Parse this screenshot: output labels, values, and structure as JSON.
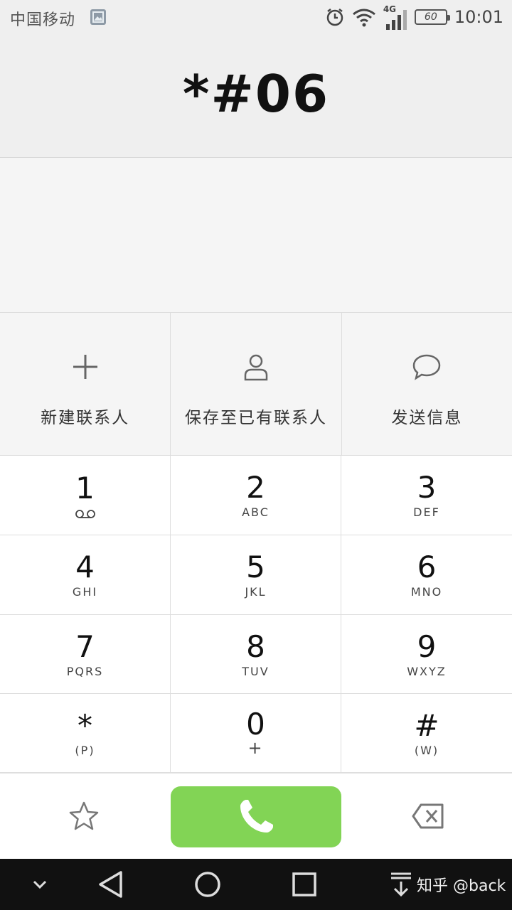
{
  "status_bar": {
    "carrier": "中国移动",
    "network_type": "4G",
    "battery_level": "60",
    "time": "10:01",
    "icons": [
      "image-notification-icon",
      "alarm-icon",
      "wifi-icon",
      "signal-icon",
      "battery-icon"
    ]
  },
  "dialer": {
    "number": "*#06"
  },
  "actions": [
    {
      "label": "新建联系人",
      "icon": "plus-icon"
    },
    {
      "label": "保存至已有联系人",
      "icon": "person-icon"
    },
    {
      "label": "发送信息",
      "icon": "message-bubble-icon"
    }
  ],
  "keypad": [
    {
      "digit": "1",
      "letters": ""
    },
    {
      "digit": "2",
      "letters": "ABC"
    },
    {
      "digit": "3",
      "letters": "DEF"
    },
    {
      "digit": "4",
      "letters": "GHI"
    },
    {
      "digit": "5",
      "letters": "JKL"
    },
    {
      "digit": "6",
      "letters": "MNO"
    },
    {
      "digit": "7",
      "letters": "PQRS"
    },
    {
      "digit": "8",
      "letters": "TUV"
    },
    {
      "digit": "9",
      "letters": "WXYZ"
    },
    {
      "digit": "*",
      "letters": "(P)"
    },
    {
      "digit": "0",
      "letters": "+"
    },
    {
      "digit": "#",
      "letters": "(W)"
    }
  ],
  "bottom_bar": {
    "icons": [
      "star-icon",
      "phone-call-icon",
      "backspace-icon"
    ],
    "call_color": "#82d455"
  },
  "nav_bar": {
    "icons": [
      "chevron-down-icon",
      "back-triangle-icon",
      "home-circle-icon",
      "recents-square-icon",
      "pull-down-icon"
    ],
    "watermark": "知乎 @back"
  }
}
